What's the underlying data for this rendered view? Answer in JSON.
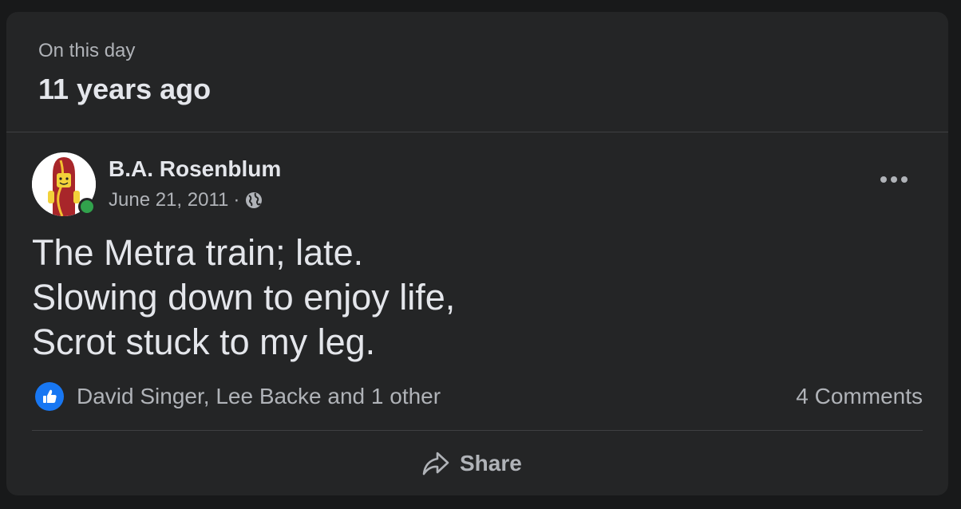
{
  "memory": {
    "subtitle": "On this day",
    "title": "11 years ago"
  },
  "post": {
    "author": "B.A. Rosenblum",
    "date": "June 21, 2011",
    "separator": "·",
    "privacy_icon": "globe-icon",
    "online": true,
    "lines": [
      "The Metra train; late.",
      "Slowing down to enjoy life,",
      "Scrot stuck to my leg."
    ]
  },
  "engagement": {
    "reaction_icon": "like-icon",
    "reactions_text": "David Singer, Lee Backe and 1 other",
    "comments_text": "4 Comments"
  },
  "actions": {
    "share_label": "Share"
  },
  "colors": {
    "background": "#18191a",
    "card": "#242526",
    "primary_text": "#e4e6eb",
    "secondary_text": "#b0b3b8",
    "like_blue": "#1877f2",
    "online_green": "#31a24c"
  }
}
